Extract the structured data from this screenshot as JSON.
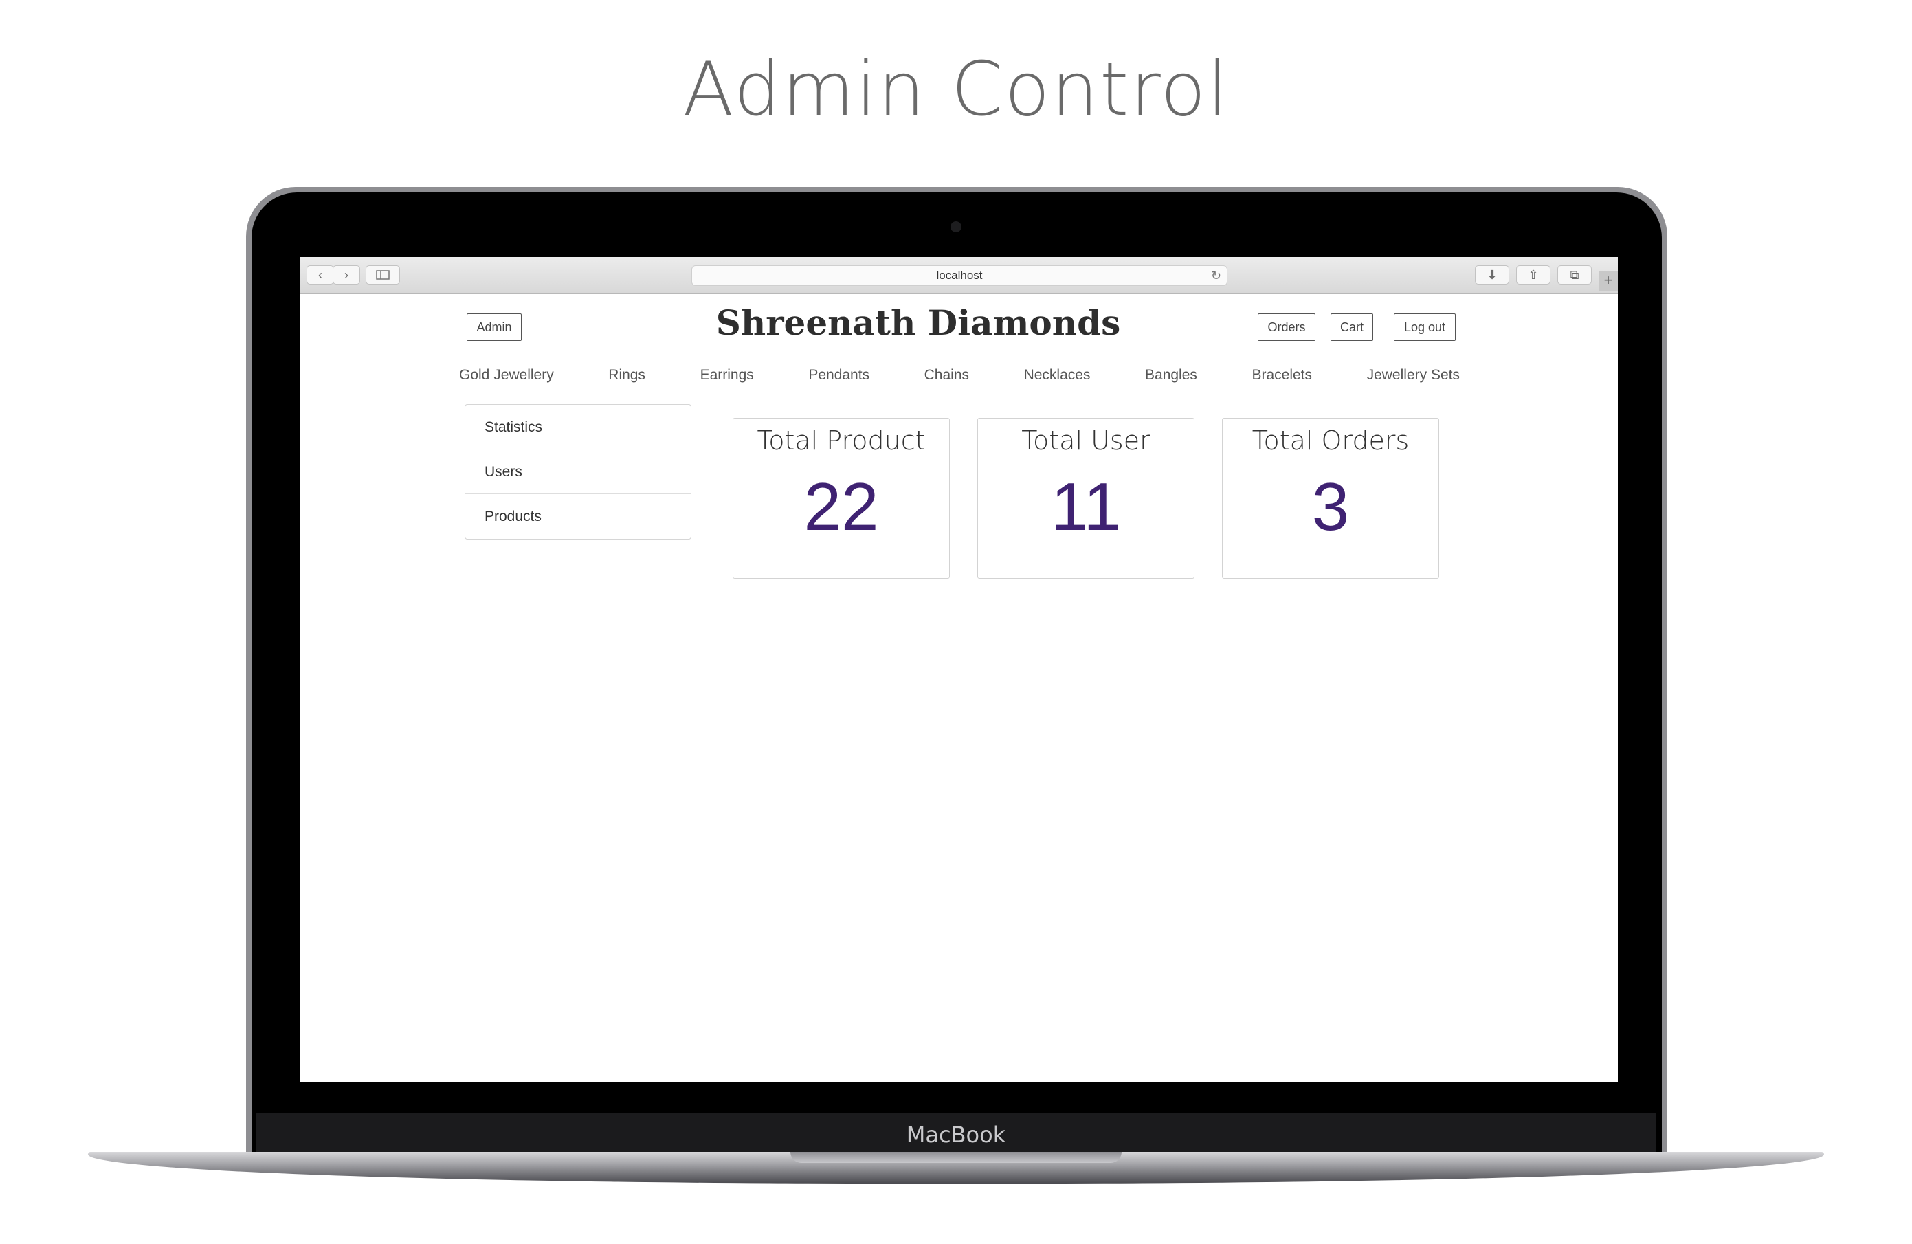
{
  "heading": "Admin Control",
  "device_brand": "MacBook",
  "browser": {
    "url": "localhost"
  },
  "site": {
    "title": "Shreenath Diamonds",
    "admin_label": "Admin",
    "actions": {
      "orders": "Orders",
      "cart": "Cart",
      "logout": "Log out"
    },
    "nav": [
      "Gold Jewellery",
      "Rings",
      "Earrings",
      "Pendants",
      "Chains",
      "Necklaces",
      "Bangles",
      "Bracelets",
      "Jewellery Sets"
    ],
    "sidebar": [
      "Statistics",
      "Users",
      "Products"
    ],
    "stats": [
      {
        "label": "Total Product",
        "value": "22"
      },
      {
        "label": "Total User",
        "value": "11"
      },
      {
        "label": "Total Orders",
        "value": "3"
      }
    ]
  },
  "colors": {
    "accent": "#3f2272",
    "heading": "#6a6a6a"
  },
  "icons": {
    "back": "chevron-left-icon",
    "forward": "chevron-right-icon",
    "sidebar_toggle": "sidebar-icon",
    "reload": "reload-icon",
    "download": "download-icon",
    "share": "share-icon",
    "tabs": "tabs-icon",
    "new_tab": "plus-icon"
  }
}
